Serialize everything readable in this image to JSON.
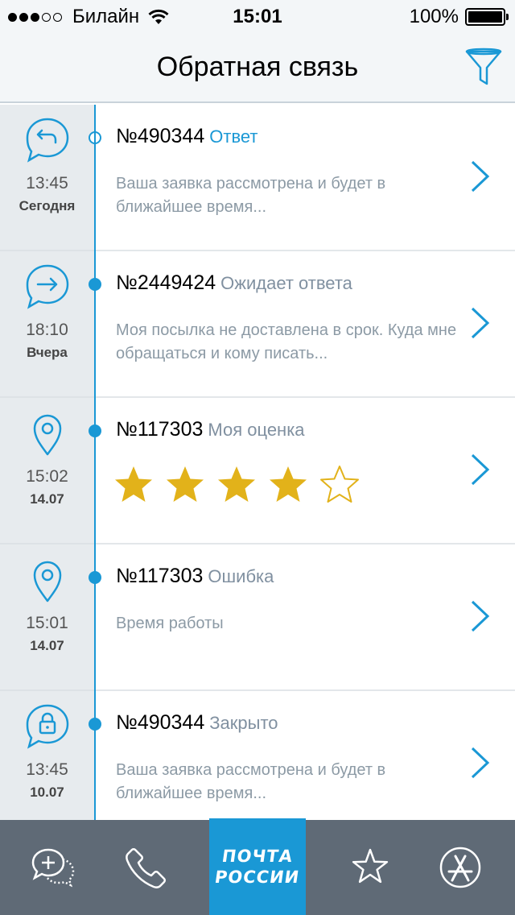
{
  "status_bar": {
    "carrier": "Билайн",
    "time": "15:01",
    "battery": "100%"
  },
  "header": {
    "title": "Обратная связь",
    "filter_icon": "filter-icon"
  },
  "tickets": [
    {
      "icon": "reply-bubble-icon",
      "time": "13:45",
      "date": "Сегодня",
      "number": "№490344",
      "status": "Ответ",
      "text": "Ваша заявка рассмотрена и будет в ближайшее время..."
    },
    {
      "icon": "forward-bubble-icon",
      "time": "18:10",
      "date": "Вчера",
      "number": "№2449424",
      "status": "Ожидает ответа",
      "text": "Моя посылка не доставлена в срок. Куда мне обращаться и кому писать..."
    },
    {
      "icon": "location-pin-icon",
      "time": "15:02",
      "date": "14.07",
      "number": "№117303",
      "status": "Моя оценка",
      "rating": 4,
      "rating_max": 5
    },
    {
      "icon": "location-pin-icon",
      "time": "15:01",
      "date": "14.07",
      "number": "№117303",
      "status": "Ошибка",
      "text": "Время работы"
    },
    {
      "icon": "lock-bubble-icon",
      "time": "13:45",
      "date": "10.07",
      "number": "№490344",
      "status": "Закрыто",
      "text": "Ваша заявка рассмотрена и будет в ближайшее время..."
    }
  ],
  "tab_bar": {
    "logo_line1": "ПОЧТА",
    "logo_line2": "РОССИИ",
    "items": [
      "new-chat-icon",
      "phone-icon",
      "pochta-logo",
      "star-icon",
      "app-store-icon"
    ]
  },
  "colors": {
    "accent": "#1a98d5",
    "star": "#e2b21a",
    "tabbar": "#586470",
    "gutter": "#e7ebee"
  }
}
